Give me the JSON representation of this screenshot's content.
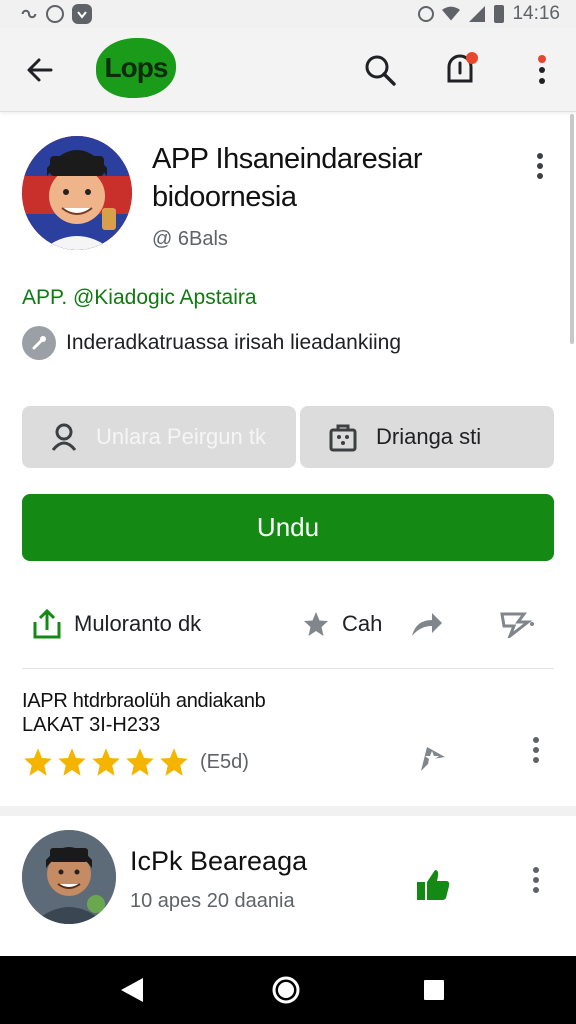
{
  "status_bar": {
    "time": "14:16",
    "left_icons": [
      "link-icon",
      "sync-icon",
      "shield-icon"
    ],
    "right_icons": [
      "nfc-icon",
      "wifi-icon",
      "signal-icon",
      "battery-icon"
    ]
  },
  "app_bar": {
    "logo_text": "Lops",
    "icons": [
      "back-arrow-icon",
      "search-icon",
      "notification-icon",
      "more-vert-icon"
    ],
    "logo_color": "#1a9b1a"
  },
  "profile": {
    "title": "APP Ihsaneindaresiar bidoornesia",
    "handle": "@ 6Bals",
    "developer": "APP. @Kiadogic Apstaira",
    "info_text": "Inderadkatruassa irisah lieadankiing"
  },
  "actions": {
    "user_chip_label": "Unlara Peirgun tk",
    "gift_chip_label": "Drianga sti",
    "install_label": "Undu",
    "share_label": "Muloranto dk",
    "save_label": "Cah"
  },
  "rating": {
    "title": "IAPR htdrbraolüh andiakanb",
    "subtitle": "LAKAT 3I-H233",
    "stars": 5,
    "count": "(E5d)"
  },
  "review": {
    "name": "IcPk Beareaga",
    "meta": "10 apes 20 daania"
  },
  "colors": {
    "accent_green": "#148a14",
    "developer_green": "#0f7a0f",
    "star_gold": "#f4b400",
    "notification_red": "#e8462e"
  }
}
